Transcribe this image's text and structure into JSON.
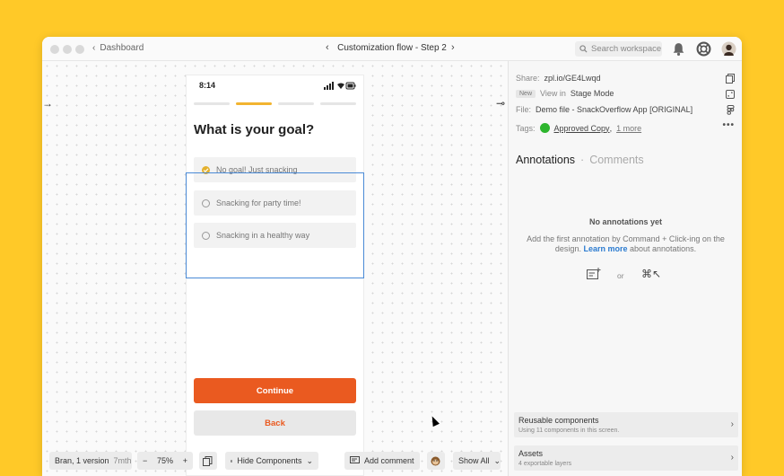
{
  "titlebar": {
    "back_label": "Dashboard",
    "flow_title": "Customization flow - Step 2",
    "search_placeholder": "Search workspace",
    "icons": [
      "bell-icon",
      "lifebuoy-icon",
      "avatar"
    ]
  },
  "phone": {
    "time": "8:14",
    "progress_steps": 4,
    "active_step": 2,
    "question": "What is your goal?",
    "options": [
      {
        "label": "No goal! Just snacking",
        "checked": true
      },
      {
        "label": "Snacking for party time!",
        "checked": false
      },
      {
        "label": "Snacking in a healthy way",
        "checked": false
      }
    ],
    "continue_label": "Continue",
    "back_label": "Back"
  },
  "panel": {
    "share_label": "Share:",
    "share_value": "zpl.io/GE4Lwqd",
    "new_badge": "New",
    "view_in_label": "View in",
    "view_in_value": "Stage Mode",
    "file_label": "File:",
    "file_value": "Demo file - SnackOverflow App [ORIGINAL]",
    "tags_label": "Tags:",
    "tag_value": "Approved Copy",
    "tag_more": "1 more",
    "tab_annotations": "Annotations",
    "tab_separator": "·",
    "tab_comments": "Comments",
    "empty_title": "No annotations yet",
    "empty_text_before": "Add the first annotation by Command + Click-ing on the design.",
    "empty_link": "Learn more",
    "empty_text_after": "about annotations.",
    "or_label": "or",
    "shortcut_label": "⌘↖",
    "reusable_title": "Reusable components",
    "reusable_sub": "Using 11 components in this screen.",
    "assets_title": "Assets",
    "assets_sub": "4 exportable layers"
  },
  "bottombar": {
    "version_label": "Bran, 1 version",
    "version_age": "7mth",
    "zoom": "75%",
    "zoom_minus": "−",
    "zoom_plus": "+",
    "hide_components": "Hide Components",
    "add_comment": "Add comment",
    "show_all": "Show All"
  },
  "colors": {
    "background": "#FFC928",
    "accent_orange": "#EA5A20",
    "selection_blue": "#4A8AD6",
    "tag_green": "#2DB52D",
    "check_yellow": "#E4B12E",
    "link_blue": "#2B7BD0"
  }
}
